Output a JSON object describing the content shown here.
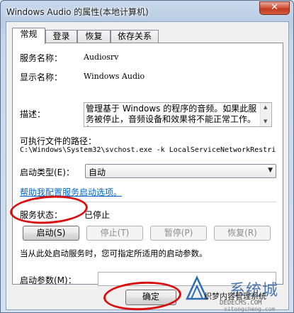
{
  "window": {
    "title": "Windows Audio 的属性(本地计算机)",
    "close_glyph": "✕"
  },
  "tabs": [
    {
      "label": "常规",
      "active": true
    },
    {
      "label": "登录",
      "active": false
    },
    {
      "label": "恢复",
      "active": false
    },
    {
      "label": "依存关系",
      "active": false
    }
  ],
  "general": {
    "service_name_label": "服务名称：",
    "service_name": "Audiosrv",
    "display_name_label": "显示名称：",
    "display_name": "Windows Audio",
    "description_label": "描述：",
    "description": "管理基于 Windows 的程序的音频。如果此服务被停止，音频设备和效果将不能正常工作。如",
    "executable_label": "可执行文件的路径：",
    "executable_path": "C:\\Windows\\System32\\svchost.exe -k LocalServiceNetworkRestri",
    "startup_type_label": "启动类型(E)：",
    "startup_type_value": "自动",
    "help_link": "帮助我配置服务启动选项。",
    "status_label": "服务状态：",
    "status_value": "已停止",
    "start_button": "启动(S)",
    "stop_button": "停止(T)",
    "pause_button": "暂停(P)",
    "resume_button": "恢复(R)",
    "hint": "当从此处启动服务时，您可指定所适用的启动参数。",
    "params_label": "启动参数(M)：",
    "params_value": ""
  },
  "footer": {
    "ok_button": "确定"
  },
  "watermark": {
    "brand": "系统城",
    "sub": "织梦内容管理系统",
    "url": "DEDECMS.COM",
    "url2": "xitongcheng.com"
  },
  "colors": {
    "highlight_ellipse": "#d81010",
    "link": "#0066cc"
  }
}
